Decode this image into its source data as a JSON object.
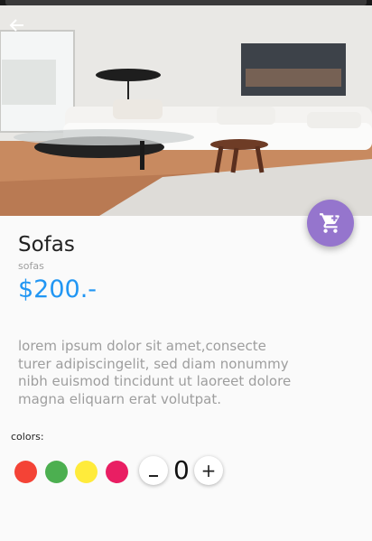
{
  "product": {
    "title": "Sofas",
    "category": "sofas",
    "price": "$200.-",
    "description": "lorem ipsum dolor sit amet,consecte turer adipiscingelit, sed diam nonummy nibh euismod tincidunt ut laoreet dolore magna eliquarn erat volutpat."
  },
  "icons": {
    "back": "arrow-left-icon",
    "cart": "cart-icon"
  },
  "colors": {
    "label": "colors:",
    "swatches": [
      "#f44336",
      "#4caf50",
      "#ffeb3b",
      "#e91e63"
    ]
  },
  "quantity": {
    "value": "0",
    "minus_label": "–",
    "plus_label": "+"
  },
  "theme": {
    "accent": "#9575cd",
    "price_color": "#2196f3"
  }
}
